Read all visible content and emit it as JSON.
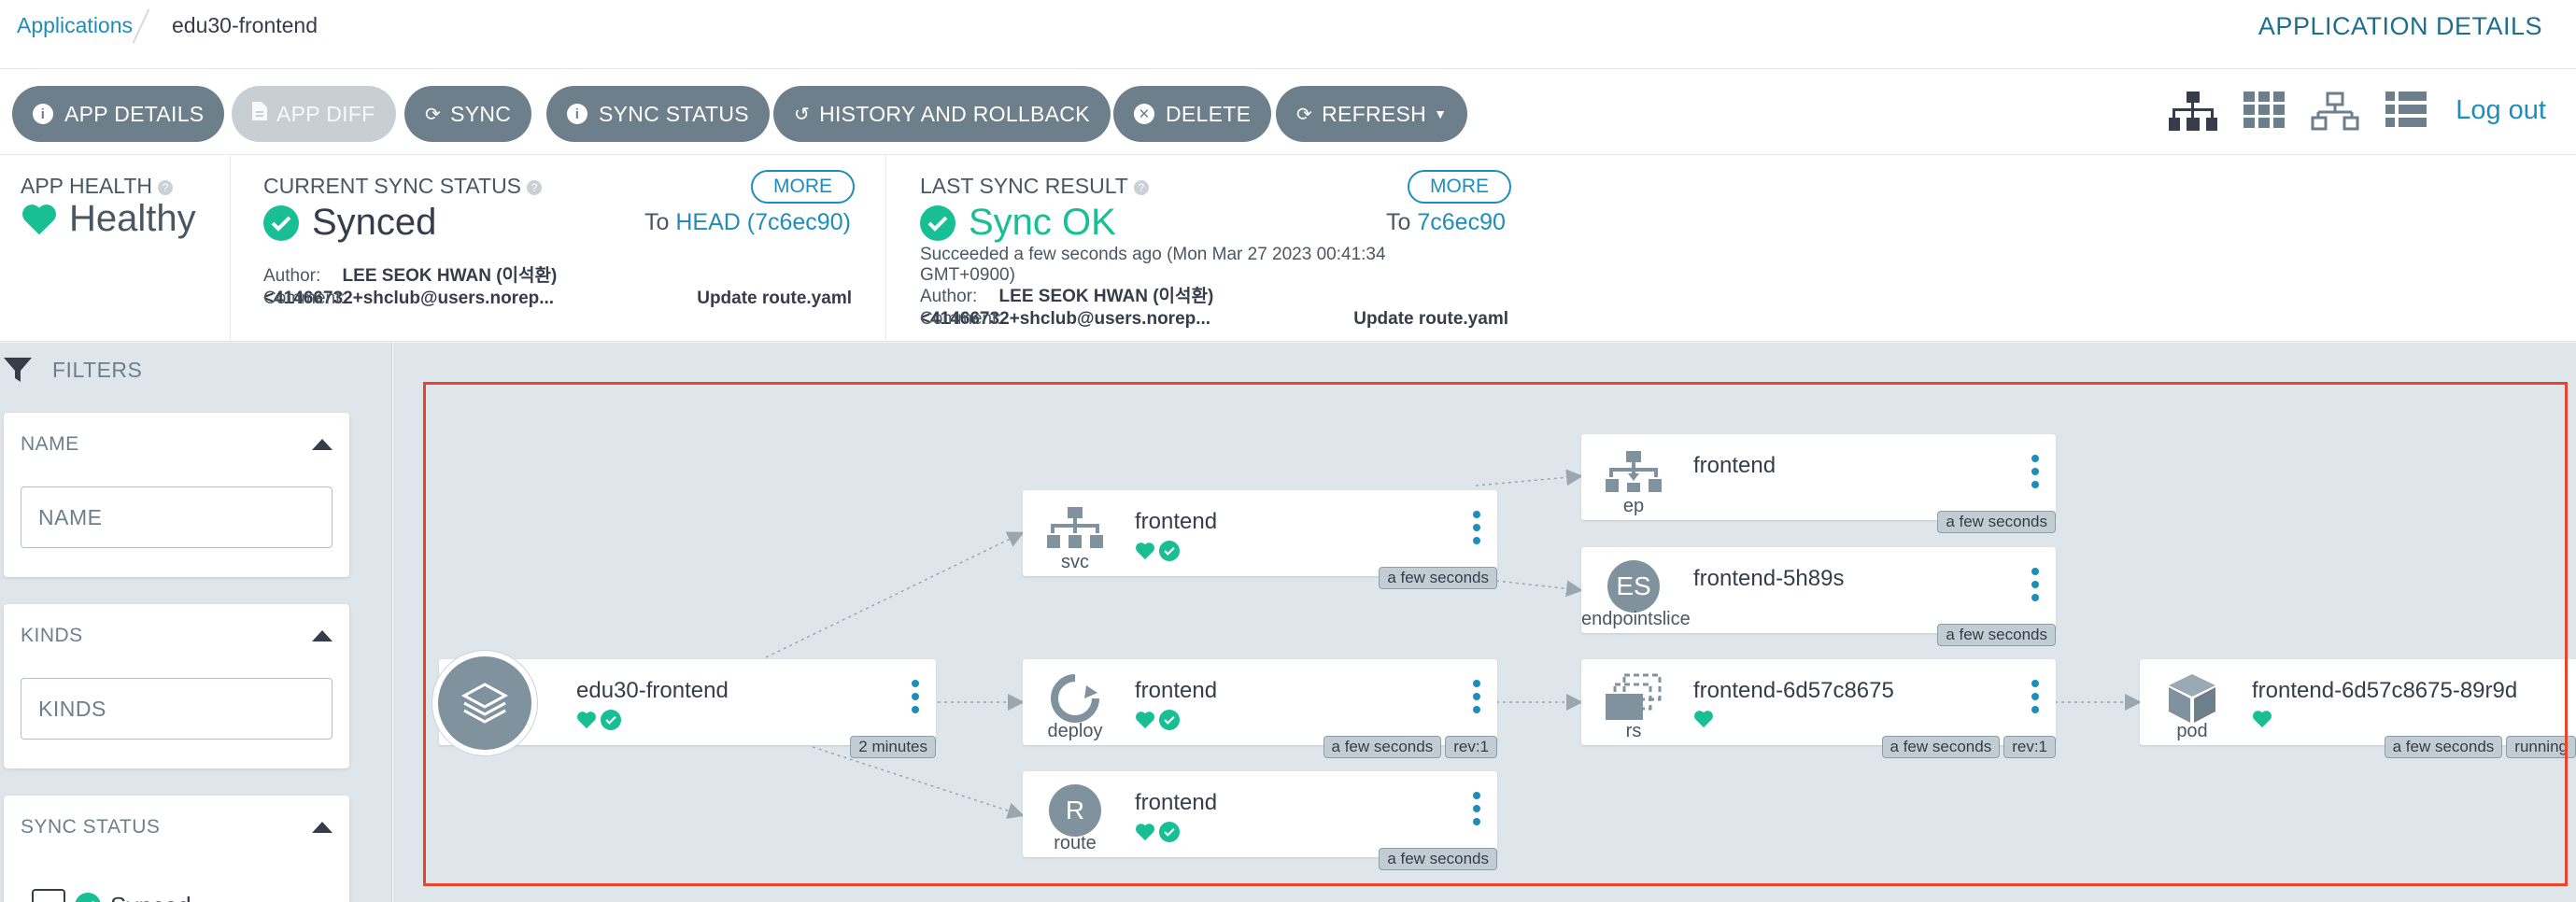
{
  "breadcrumb": {
    "root": "Applications",
    "current": "edu30-frontend"
  },
  "page_title": "APPLICATION DETAILS",
  "toolbar": {
    "app_details": "APP DETAILS",
    "app_diff": "APP DIFF",
    "sync": "SYNC",
    "sync_status": "SYNC STATUS",
    "history": "HISTORY AND ROLLBACK",
    "delete": "DELETE",
    "refresh": "REFRESH",
    "logout": "Log out",
    "view_icons": [
      "tree-view-icon",
      "pods-view-icon",
      "network-view-icon",
      "list-view-icon"
    ]
  },
  "status": {
    "health_label": "APP HEALTH",
    "health_value": "Healthy",
    "sync_label": "CURRENT SYNC STATUS",
    "sync_value": "Synced",
    "sync_more": "MORE",
    "sync_to": "To",
    "sync_rev": "HEAD (7c6ec90)",
    "sync_author_label": "Author:",
    "sync_author": "LEE SEOK HWAN (이석환) <41466732+shclub@users.norep...",
    "sync_comment_label": "Comment:",
    "sync_comment": "Update route.yaml",
    "last_label": "LAST SYNC RESULT",
    "last_value": "Sync OK",
    "last_more": "MORE",
    "last_to": "To",
    "last_rev": "7c6ec90",
    "last_time_1": "Succeeded a few seconds ago (Mon Mar 27 2023 00:41:34",
    "last_time_2": "GMT+0900)",
    "last_author_label": "Author:",
    "last_author": "LEE SEOK HWAN (이석환) <41466732+shclub@users.norep...",
    "last_comment_label": "Comment:",
    "last_comment": "Update route.yaml"
  },
  "filters": {
    "header": "FILTERS",
    "name_title": "NAME",
    "name_placeholder": "NAME",
    "kinds_title": "KINDS",
    "kinds_placeholder": "KINDS",
    "sync_title": "SYNC STATUS",
    "sync_option": "Synced"
  },
  "graph": {
    "app": {
      "name": "edu30-frontend",
      "tag": "2 minutes"
    },
    "svc": {
      "name": "frontend",
      "kind": "svc",
      "tag": "a few seconds"
    },
    "deploy": {
      "name": "frontend",
      "kind": "deploy",
      "tag1": "a few seconds",
      "tag2": "rev:1"
    },
    "route": {
      "name": "frontend",
      "kind": "route",
      "tag": "a few seconds",
      "letter": "R"
    },
    "ep": {
      "name": "frontend",
      "kind": "ep",
      "tag": "a few seconds"
    },
    "eps": {
      "name": "frontend-5h89s",
      "kind": "endpointslice",
      "tag": "a few seconds",
      "letter": "ES"
    },
    "rs": {
      "name": "frontend-6d57c8675",
      "kind": "rs",
      "tag1": "a few seconds",
      "tag2": "rev:1"
    },
    "pod": {
      "name": "frontend-6d57c8675-89r9d",
      "kind": "pod",
      "tag1": "a few seconds",
      "tag2": "running"
    }
  },
  "colors": {
    "healthy": "#18be94",
    "link": "#1f8dba",
    "button": "#6d7f8b",
    "highlight": "#e8452c"
  }
}
